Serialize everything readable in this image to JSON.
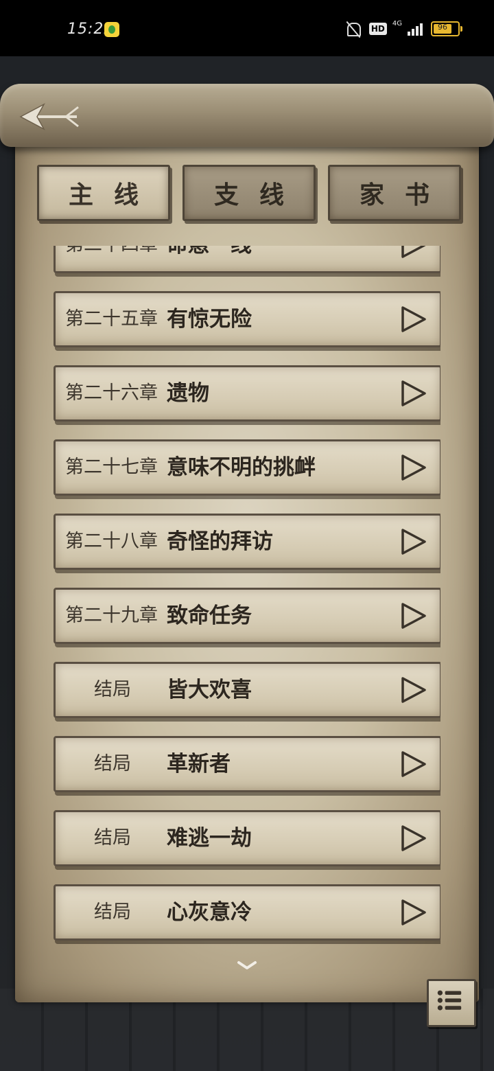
{
  "status_bar": {
    "time": "15:22",
    "network_hd": "HD",
    "network_type": "4G",
    "battery_level": "96"
  },
  "tabs": [
    {
      "label": "主线",
      "active": true
    },
    {
      "label": "支线",
      "active": false
    },
    {
      "label": "家书",
      "active": false
    }
  ],
  "chapters": [
    {
      "number": "第二十四章",
      "title": "命悬一线"
    },
    {
      "number": "第二十五章",
      "title": "有惊无险"
    },
    {
      "number": "第二十六章",
      "title": "遗物"
    },
    {
      "number": "第二十七章",
      "title": "意味不明的挑衅"
    },
    {
      "number": "第二十八章",
      "title": "奇怪的拜访"
    },
    {
      "number": "第二十九章",
      "title": "致命任务"
    },
    {
      "number": "结局",
      "title": "皆大欢喜"
    },
    {
      "number": "结局",
      "title": "革新者"
    },
    {
      "number": "结局",
      "title": "难逃一劫"
    },
    {
      "number": "结局",
      "title": "心灰意冷"
    }
  ]
}
